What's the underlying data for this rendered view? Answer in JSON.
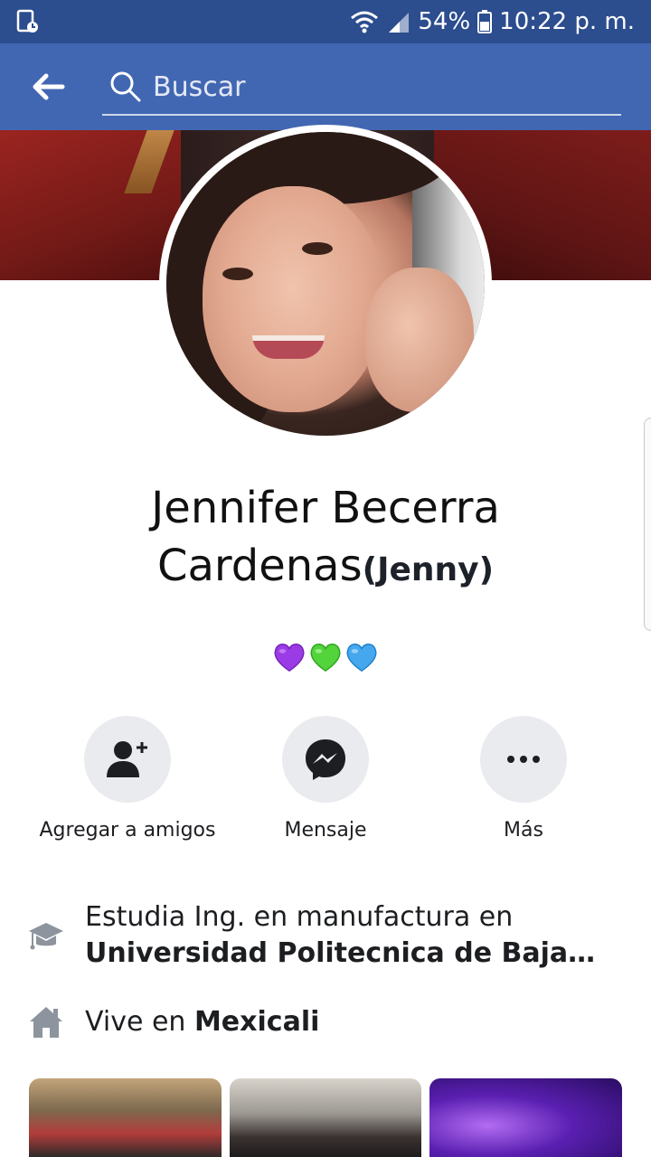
{
  "status_bar": {
    "battery": "54%",
    "time": "10:22 p. m.",
    "icons": [
      "screen-recorder-icon",
      "wifi-icon",
      "signal-icon",
      "battery-icon"
    ]
  },
  "header": {
    "search_placeholder": "Buscar",
    "back_icon": "back-arrow-icon",
    "search_icon": "search-icon",
    "background_color": "#4267b2",
    "status_bar_color": "#2c4d8e"
  },
  "profile": {
    "name_line1": "Jennifer Becerra",
    "name_line2": "Cardenas",
    "nickname": "(Jenny)",
    "bio_emojis": [
      "purple-heart",
      "green-heart",
      "blue-heart"
    ]
  },
  "actions": [
    {
      "label": "Agregar a amigos",
      "icon": "add-friend-icon"
    },
    {
      "label": "Mensaje",
      "icon": "messenger-icon"
    },
    {
      "label": "Más",
      "icon": "more-icon"
    }
  ],
  "intro": {
    "education_prefix": "Estudia Ing. en manufactura en",
    "education_school": "Universidad Politecnica de Baja California",
    "lives_prefix": "Vive en ",
    "lives_city": "Mexicali"
  }
}
